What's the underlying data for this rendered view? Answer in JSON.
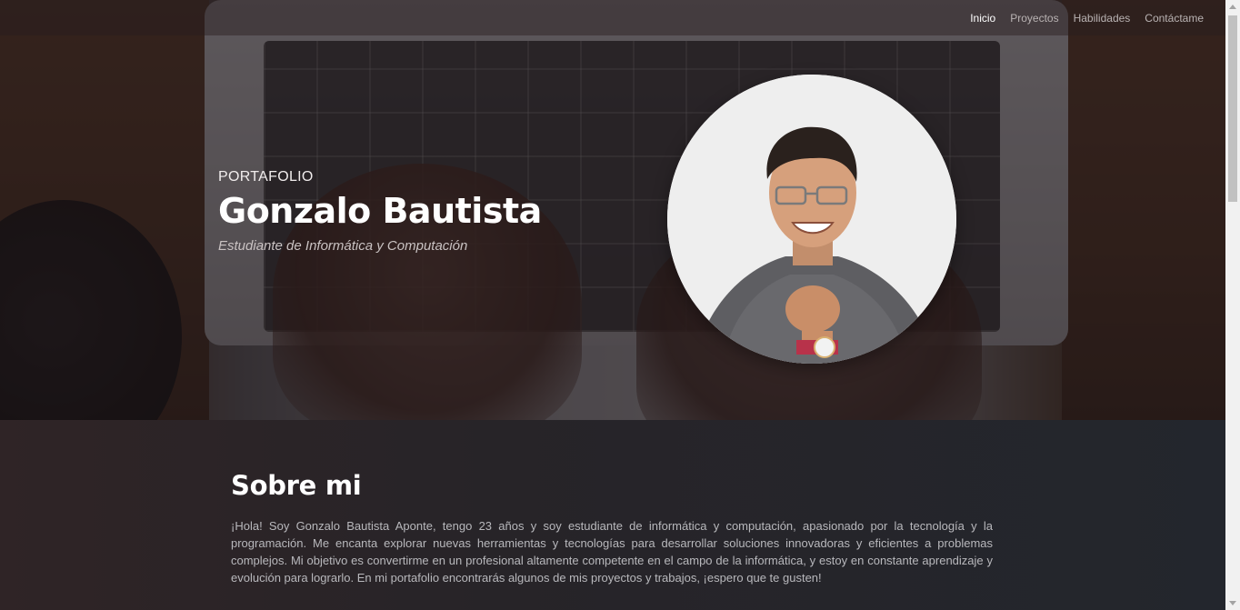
{
  "nav": {
    "items": [
      {
        "label": "Inicio",
        "active": true
      },
      {
        "label": "Proyectos",
        "active": false
      },
      {
        "label": "Habilidades",
        "active": false
      },
      {
        "label": "Contáctame",
        "active": false
      }
    ]
  },
  "hero": {
    "eyebrow": "PORTAFOLIO",
    "name": "Gonzalo Bautista",
    "tagline": "Estudiante de Informática y Computación"
  },
  "about": {
    "title": "Sobre mi",
    "text": "¡Hola! Soy Gonzalo Bautista Aponte, tengo 23 años y soy estudiante de informática y computación, apasionado por la tecnología y la programación. Me encanta explorar nuevas herramientas y tecnologías para desarrollar soluciones innovadoras y eficientes a problemas complejos. Mi objetivo es convertirme en un profesional altamente competente en el campo de la informática, y estoy en constante aprendizaje y evolución para lograrlo. En mi portafolio encontrarás algunos de mis proyectos y trabajos, ¡espero que te gusten!"
  },
  "colors": {
    "active_nav": "#ffffff",
    "nav": "#b9b3b3",
    "about_bg": "#23262d",
    "body_text": "#b8b8bc"
  }
}
